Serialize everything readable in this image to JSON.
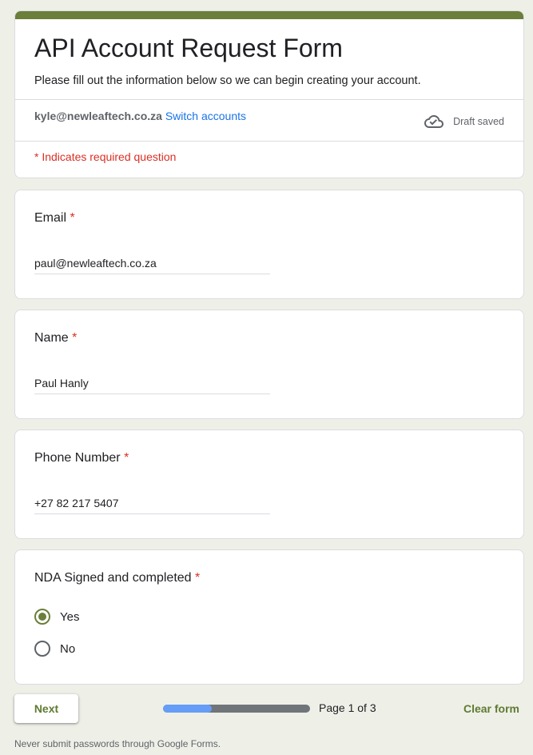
{
  "header": {
    "title": "API Account Request Form",
    "description": "Please fill out the information below so we can begin creating your account.",
    "account_email": "kyle@newleaftech.co.za",
    "switch_accounts": "Switch accounts",
    "draft_status": "Draft saved",
    "required_note": "* Indicates required question"
  },
  "questions": {
    "email": {
      "label": "Email",
      "required_mark": "*",
      "value": "paul@newleaftech.co.za"
    },
    "name": {
      "label": "Name",
      "required_mark": "*",
      "value": "Paul Hanly"
    },
    "phone": {
      "label": "Phone Number",
      "required_mark": "*",
      "value": "+27 82 217 5407"
    },
    "nda": {
      "label": "NDA Signed and completed",
      "required_mark": "*",
      "options": [
        "Yes",
        "No"
      ],
      "selected": "Yes"
    }
  },
  "footer": {
    "next_label": "Next",
    "page_indicator": "Page 1 of 3",
    "progress_fraction": 0.333,
    "clear_label": "Clear form",
    "note": "Never submit passwords through Google Forms."
  },
  "colors": {
    "accent": "#6b7e3a",
    "required": "#d93025",
    "link": "#1a73e8",
    "progress_fill": "#669df6"
  }
}
